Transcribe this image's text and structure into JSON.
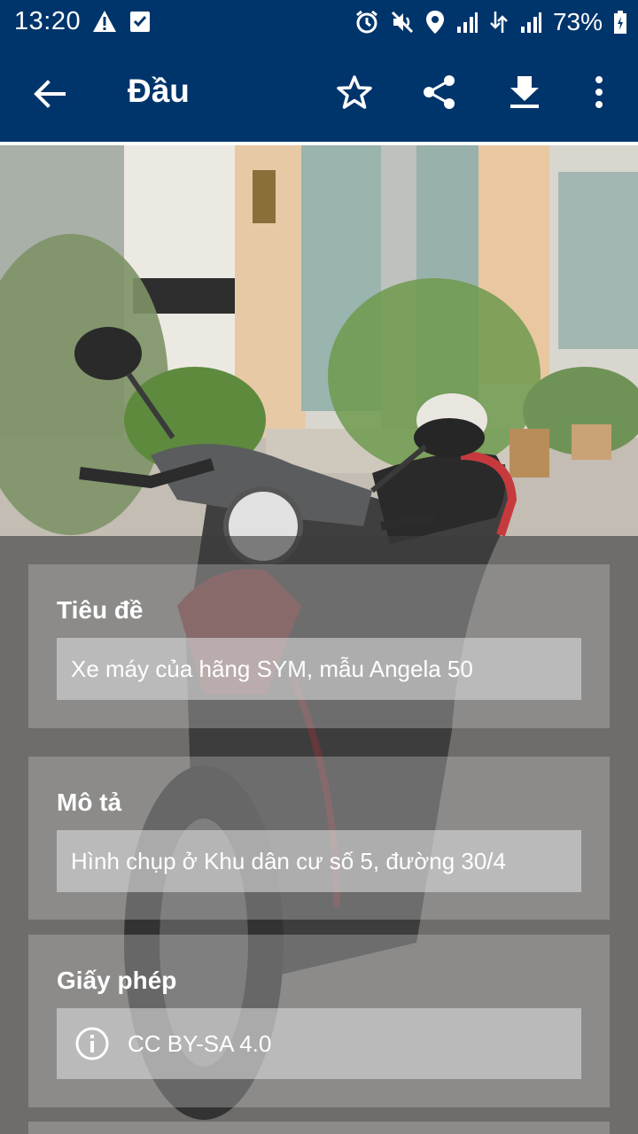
{
  "status_bar": {
    "time": "13:20",
    "battery_percent": "73%",
    "icons_left": [
      "warning-icon",
      "checkbox-icon"
    ],
    "icons_right": [
      "alarm-icon",
      "mute-icon",
      "location-icon",
      "signal-icon",
      "data-icon",
      "signal-icon",
      "battery-icon"
    ]
  },
  "app_bar": {
    "title": "Đầu",
    "actions": [
      "star-icon",
      "share-icon",
      "download-icon",
      "more-icon"
    ]
  },
  "cards": {
    "title": {
      "label": "Tiêu đề",
      "value": "Xe máy của hãng SYM, mẫu Angela 50"
    },
    "description": {
      "label": "Mô tả",
      "value": "Hình chụp ở Khu dân cư số 5, đường 30/4"
    },
    "license": {
      "label": "Giấy phép",
      "value": "CC BY-SA 4.0"
    }
  },
  "colors": {
    "app_bar": "#00356b",
    "text": "#ffffff"
  }
}
